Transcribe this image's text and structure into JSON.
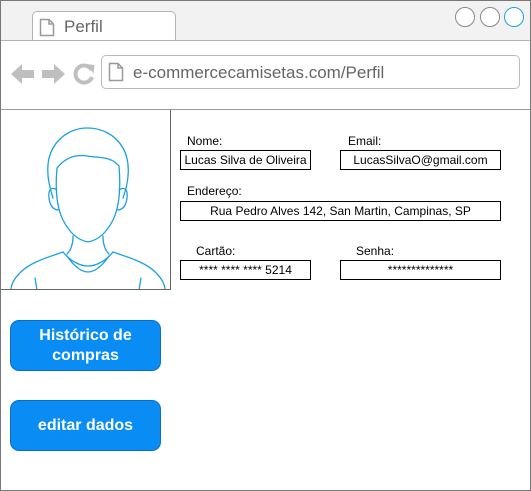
{
  "browser": {
    "tab_title": "Perfil",
    "url": "e-commercecamisetas.com/Perfil"
  },
  "icons": [
    "document-icon",
    "back-arrow-icon",
    "forward-arrow-icon",
    "reload-icon",
    "avatar-icon"
  ],
  "colors": {
    "button_bg": "#0a8cf5",
    "window_button_accent": "#1ba1e2",
    "avatar_stroke": "#1ba1e2"
  },
  "profile": {
    "name_label": "Nome:",
    "name_value": "Lucas Silva de Oliveira",
    "email_label": "Email:",
    "email_value": "LucasSilvaO@gmail.com",
    "address_label": "Endereço:",
    "address_value": "Rua Pedro Alves 142, San Martin, Campinas, SP",
    "card_label": "Cartão:",
    "card_value": "**** **** **** 5214",
    "password_label": "Senha:",
    "password_value": "**************"
  },
  "actions": {
    "history_label": "Histórico de compras",
    "edit_label": "editar dados"
  }
}
